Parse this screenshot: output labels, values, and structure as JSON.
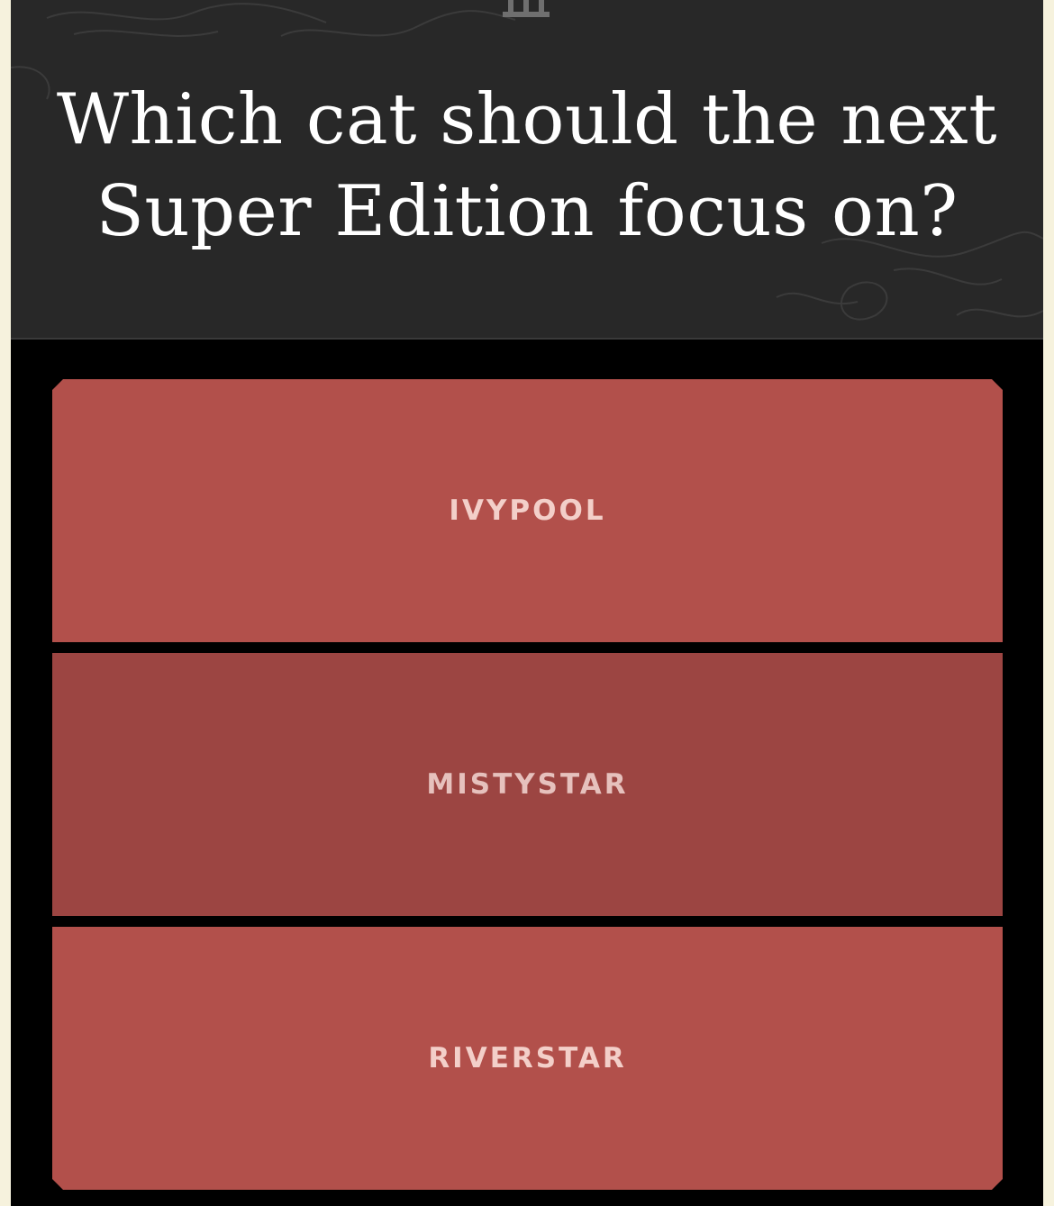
{
  "poll": {
    "question": "Which cat should the next Super Edition focus on?",
    "options": [
      {
        "label": "IVYPOOL",
        "state": "normal"
      },
      {
        "label": "MISTYSTAR",
        "state": "highlighted"
      },
      {
        "label": "RIVERSTAR",
        "state": "normal"
      }
    ]
  },
  "colors": {
    "page_background": "#f6f2dd",
    "card_background": "#000000",
    "header_background": "#282828",
    "title_text": "#ffffff",
    "option_background": "#b2504b",
    "option_background_highlighted": "#9c4542",
    "option_text": "#f3cfc9",
    "option_text_highlighted": "#e6c1bd"
  },
  "icons": {
    "header_tab": "pillar-icon"
  }
}
